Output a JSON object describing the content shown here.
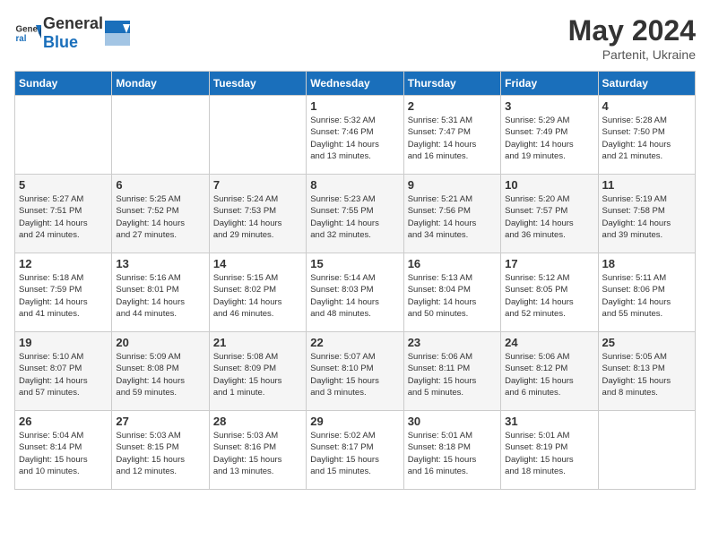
{
  "header": {
    "logo_general": "General",
    "logo_blue": "Blue",
    "title": "May 2024",
    "location": "Partenit, Ukraine"
  },
  "weekdays": [
    "Sunday",
    "Monday",
    "Tuesday",
    "Wednesday",
    "Thursday",
    "Friday",
    "Saturday"
  ],
  "weeks": [
    [
      {
        "day": "",
        "info": ""
      },
      {
        "day": "",
        "info": ""
      },
      {
        "day": "",
        "info": ""
      },
      {
        "day": "1",
        "info": "Sunrise: 5:32 AM\nSunset: 7:46 PM\nDaylight: 14 hours\nand 13 minutes."
      },
      {
        "day": "2",
        "info": "Sunrise: 5:31 AM\nSunset: 7:47 PM\nDaylight: 14 hours\nand 16 minutes."
      },
      {
        "day": "3",
        "info": "Sunrise: 5:29 AM\nSunset: 7:49 PM\nDaylight: 14 hours\nand 19 minutes."
      },
      {
        "day": "4",
        "info": "Sunrise: 5:28 AM\nSunset: 7:50 PM\nDaylight: 14 hours\nand 21 minutes."
      }
    ],
    [
      {
        "day": "5",
        "info": "Sunrise: 5:27 AM\nSunset: 7:51 PM\nDaylight: 14 hours\nand 24 minutes."
      },
      {
        "day": "6",
        "info": "Sunrise: 5:25 AM\nSunset: 7:52 PM\nDaylight: 14 hours\nand 27 minutes."
      },
      {
        "day": "7",
        "info": "Sunrise: 5:24 AM\nSunset: 7:53 PM\nDaylight: 14 hours\nand 29 minutes."
      },
      {
        "day": "8",
        "info": "Sunrise: 5:23 AM\nSunset: 7:55 PM\nDaylight: 14 hours\nand 32 minutes."
      },
      {
        "day": "9",
        "info": "Sunrise: 5:21 AM\nSunset: 7:56 PM\nDaylight: 14 hours\nand 34 minutes."
      },
      {
        "day": "10",
        "info": "Sunrise: 5:20 AM\nSunset: 7:57 PM\nDaylight: 14 hours\nand 36 minutes."
      },
      {
        "day": "11",
        "info": "Sunrise: 5:19 AM\nSunset: 7:58 PM\nDaylight: 14 hours\nand 39 minutes."
      }
    ],
    [
      {
        "day": "12",
        "info": "Sunrise: 5:18 AM\nSunset: 7:59 PM\nDaylight: 14 hours\nand 41 minutes."
      },
      {
        "day": "13",
        "info": "Sunrise: 5:16 AM\nSunset: 8:01 PM\nDaylight: 14 hours\nand 44 minutes."
      },
      {
        "day": "14",
        "info": "Sunrise: 5:15 AM\nSunset: 8:02 PM\nDaylight: 14 hours\nand 46 minutes."
      },
      {
        "day": "15",
        "info": "Sunrise: 5:14 AM\nSunset: 8:03 PM\nDaylight: 14 hours\nand 48 minutes."
      },
      {
        "day": "16",
        "info": "Sunrise: 5:13 AM\nSunset: 8:04 PM\nDaylight: 14 hours\nand 50 minutes."
      },
      {
        "day": "17",
        "info": "Sunrise: 5:12 AM\nSunset: 8:05 PM\nDaylight: 14 hours\nand 52 minutes."
      },
      {
        "day": "18",
        "info": "Sunrise: 5:11 AM\nSunset: 8:06 PM\nDaylight: 14 hours\nand 55 minutes."
      }
    ],
    [
      {
        "day": "19",
        "info": "Sunrise: 5:10 AM\nSunset: 8:07 PM\nDaylight: 14 hours\nand 57 minutes."
      },
      {
        "day": "20",
        "info": "Sunrise: 5:09 AM\nSunset: 8:08 PM\nDaylight: 14 hours\nand 59 minutes."
      },
      {
        "day": "21",
        "info": "Sunrise: 5:08 AM\nSunset: 8:09 PM\nDaylight: 15 hours\nand 1 minute."
      },
      {
        "day": "22",
        "info": "Sunrise: 5:07 AM\nSunset: 8:10 PM\nDaylight: 15 hours\nand 3 minutes."
      },
      {
        "day": "23",
        "info": "Sunrise: 5:06 AM\nSunset: 8:11 PM\nDaylight: 15 hours\nand 5 minutes."
      },
      {
        "day": "24",
        "info": "Sunrise: 5:06 AM\nSunset: 8:12 PM\nDaylight: 15 hours\nand 6 minutes."
      },
      {
        "day": "25",
        "info": "Sunrise: 5:05 AM\nSunset: 8:13 PM\nDaylight: 15 hours\nand 8 minutes."
      }
    ],
    [
      {
        "day": "26",
        "info": "Sunrise: 5:04 AM\nSunset: 8:14 PM\nDaylight: 15 hours\nand 10 minutes."
      },
      {
        "day": "27",
        "info": "Sunrise: 5:03 AM\nSunset: 8:15 PM\nDaylight: 15 hours\nand 12 minutes."
      },
      {
        "day": "28",
        "info": "Sunrise: 5:03 AM\nSunset: 8:16 PM\nDaylight: 15 hours\nand 13 minutes."
      },
      {
        "day": "29",
        "info": "Sunrise: 5:02 AM\nSunset: 8:17 PM\nDaylight: 15 hours\nand 15 minutes."
      },
      {
        "day": "30",
        "info": "Sunrise: 5:01 AM\nSunset: 8:18 PM\nDaylight: 15 hours\nand 16 minutes."
      },
      {
        "day": "31",
        "info": "Sunrise: 5:01 AM\nSunset: 8:19 PM\nDaylight: 15 hours\nand 18 minutes."
      },
      {
        "day": "",
        "info": ""
      }
    ]
  ]
}
